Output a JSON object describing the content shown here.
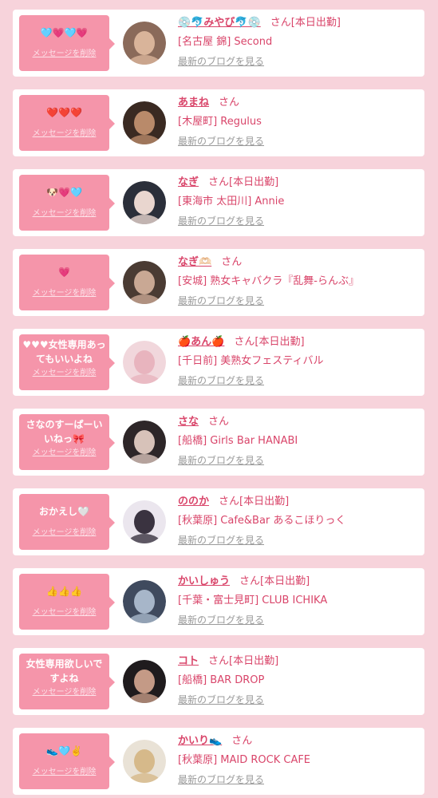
{
  "cards": [
    {
      "message": "🩵💗🩵💗",
      "delete_label": "メッセージを削除",
      "name": "💿🐬みやび🐬💿",
      "honorific": "さん",
      "today": "[本日出勤]",
      "shop": "[名古屋 錦] Second",
      "blog_link": "最新のブログを見る",
      "avatar_colors": [
        "#8a6a5a",
        "#d9b49a"
      ]
    },
    {
      "message": "❤️❤️❤️",
      "delete_label": "メッセージを削除",
      "name": "あまね",
      "honorific": "さん",
      "today": "",
      "shop": "[木屋町] Regulus",
      "blog_link": "最新のブログを見る",
      "avatar_colors": [
        "#3a2a22",
        "#b98a6a"
      ]
    },
    {
      "message": "🐶💗🩵",
      "delete_label": "メッセージを削除",
      "name": "なぎ",
      "honorific": "さん",
      "today": "[本日出勤]",
      "shop": "[東海市 太田川] Annie",
      "blog_link": "最新のブログを見る",
      "avatar_colors": [
        "#2b2f3a",
        "#e9d6cf"
      ]
    },
    {
      "message": "💗",
      "delete_label": "メッセージを削除",
      "name": "なぎ🫶🏻",
      "honorific": "さん",
      "today": "",
      "shop": "[安城] 熟女キャバクラ『乱舞-らんぶ』",
      "blog_link": "最新のブログを見る",
      "avatar_colors": [
        "#4a3b33",
        "#c9a894"
      ]
    },
    {
      "message": "♥♥♥女性専用あってもいいよね",
      "delete_label": "メッセージを削除",
      "name": "🍎あん🍎",
      "honorific": "さん",
      "today": "[本日出勤]",
      "shop": "[千日前] 美熟女フェスティバル",
      "blog_link": "最新のブログを見る",
      "avatar_colors": [
        "#f1d7dc",
        "#e8b4be"
      ]
    },
    {
      "message": "さなのすーぱーいいねっ🎀",
      "delete_label": "メッセージを削除",
      "name": "さな",
      "honorific": "さん",
      "today": "",
      "shop": "[船橋] Girls Bar HANABI",
      "blog_link": "最新のブログを見る",
      "avatar_colors": [
        "#2d2628",
        "#d7c2b9"
      ]
    },
    {
      "message": "おかえし🤍",
      "delete_label": "メッセージを削除",
      "name": "ののか",
      "honorific": "さん",
      "today": "[本日出勤]",
      "shop": "[秋葉原] Cafe&Bar あるこほりっく",
      "blog_link": "最新のブログを見る",
      "avatar_colors": [
        "#ebe6ee",
        "#3a3340"
      ]
    },
    {
      "message": "👍👍👍",
      "delete_label": "メッセージを削除",
      "name": "かいしゅう",
      "honorific": "さん",
      "today": "[本日出勤]",
      "shop": "[千葉・富士見町] CLUB ICHIKA",
      "blog_link": "最新のブログを見る",
      "avatar_colors": [
        "#3f4a5e",
        "#a7b6c9"
      ]
    },
    {
      "message": "女性専用欲しいですよね",
      "delete_label": "メッセージを削除",
      "name": "コト",
      "honorific": "さん",
      "today": "[本日出勤]",
      "shop": "[船橋] BAR DROP",
      "blog_link": "最新のブログを見る",
      "avatar_colors": [
        "#1f1b1d",
        "#c49a86"
      ]
    },
    {
      "message": "👟🩵✌️",
      "delete_label": "メッセージを削除",
      "name": "かいり👟",
      "honorific": "さん",
      "today": "",
      "shop": "[秋葉原] MAID ROCK CAFE",
      "blog_link": "最新のブログを見る",
      "avatar_colors": [
        "#e9e2d6",
        "#d6b98a"
      ]
    }
  ]
}
